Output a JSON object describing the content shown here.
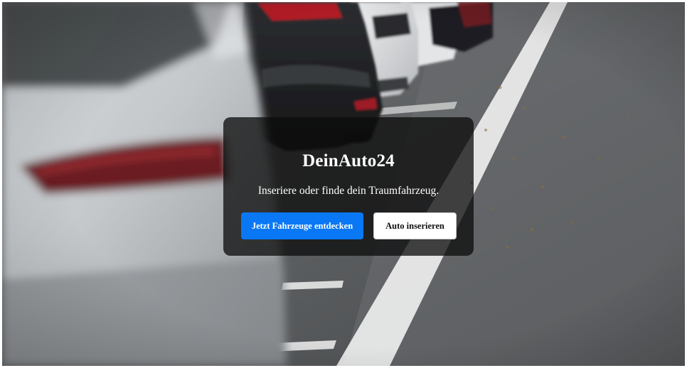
{
  "hero": {
    "background": "parking-lot-cars-photo"
  },
  "card": {
    "title": "DeinAuto24",
    "subtitle": "Inseriere oder finde dein Traumfahrzeug.",
    "primary_button_label": "Jetzt Fahrzeuge entdecken",
    "secondary_button_label": "Auto inserieren"
  },
  "colors": {
    "primary": "#0a78f5",
    "overlay": "#0c0c0c",
    "secondary_bg": "#ffffff"
  }
}
